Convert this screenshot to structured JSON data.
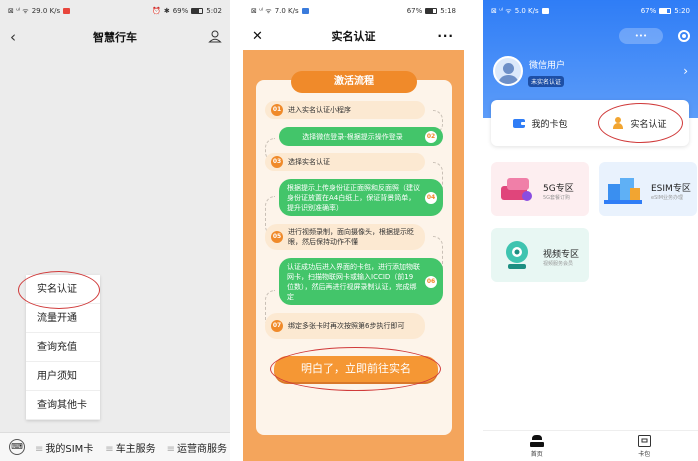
{
  "colors": {
    "accent_orange": "#f08a2a",
    "accent_green": "#43c56a",
    "brand_blue": "#2f7df6",
    "annotation_red": "#d03a3a"
  },
  "panel1": {
    "status": {
      "carrier": "⊠ ᵘˡ ᯤ",
      "speed": "29.0 K/s",
      "battery": "69%",
      "time": "5:02",
      "alarm": "⏰",
      "bt": "✱"
    },
    "title": "智慧行车",
    "back_icon": "‹",
    "user_icon": "person-icon",
    "menu": [
      "实名认证",
      "流量开通",
      "查询充值",
      "用户须知",
      "查询其他卡"
    ],
    "tabbar": {
      "keyboard_icon": "⌨",
      "tabs": [
        "我的SIM卡",
        "车主服务",
        "运营商服务"
      ]
    }
  },
  "panel2": {
    "status": {
      "carrier": "⊠ ᵘˡ ᯤ",
      "speed": "7.0 K/s",
      "battery": "67%",
      "time": "5:18"
    },
    "title": "实名认证",
    "close_icon": "✕",
    "more_icon": "···",
    "banner": "激活流程",
    "steps": [
      {
        "num": "01",
        "text": "进入实名认证小程序"
      },
      {
        "num": "02",
        "text": "选择微信登录-根据提示操作登录"
      },
      {
        "num": "03",
        "text": "选择实名认证"
      },
      {
        "num": "04",
        "text": "根据提示上传身份证正面照和反面照（建议身份证放置在A4白纸上，保证背景简单，提升识别准确率）"
      },
      {
        "num": "05",
        "text": "进行视频录制，面向摄像头，根据提示眨眼，然后保持动作不懂"
      },
      {
        "num": "06",
        "text": "认证成功后进入界面的卡包，进行添加物联网卡，扫描物联网卡或输入ICCID（前19位数），然后再进行视屏录制认证，完成绑定"
      },
      {
        "num": "07",
        "text": "绑定多张卡时再次按照第6步执行即可"
      }
    ],
    "cta": "明白了，立即前往实名"
  },
  "panel3": {
    "status": {
      "carrier": "⊠ ᵘˡ ᯤ",
      "speed": "5.0 K/s",
      "battery": "67%",
      "time": "5:20"
    },
    "capsule": "•••",
    "username": "微信用户",
    "badge": "未实名认证",
    "quick": [
      "我的卡包",
      "实名认证"
    ],
    "tiles": [
      {
        "name": "5G专区",
        "sub": "5G套餐订购"
      },
      {
        "name": "ESIM专区",
        "sub": "eSIM业务办理"
      },
      {
        "name": "视频专区",
        "sub": "视频服务会员"
      }
    ],
    "tabbar": [
      "首页",
      "卡包"
    ]
  }
}
